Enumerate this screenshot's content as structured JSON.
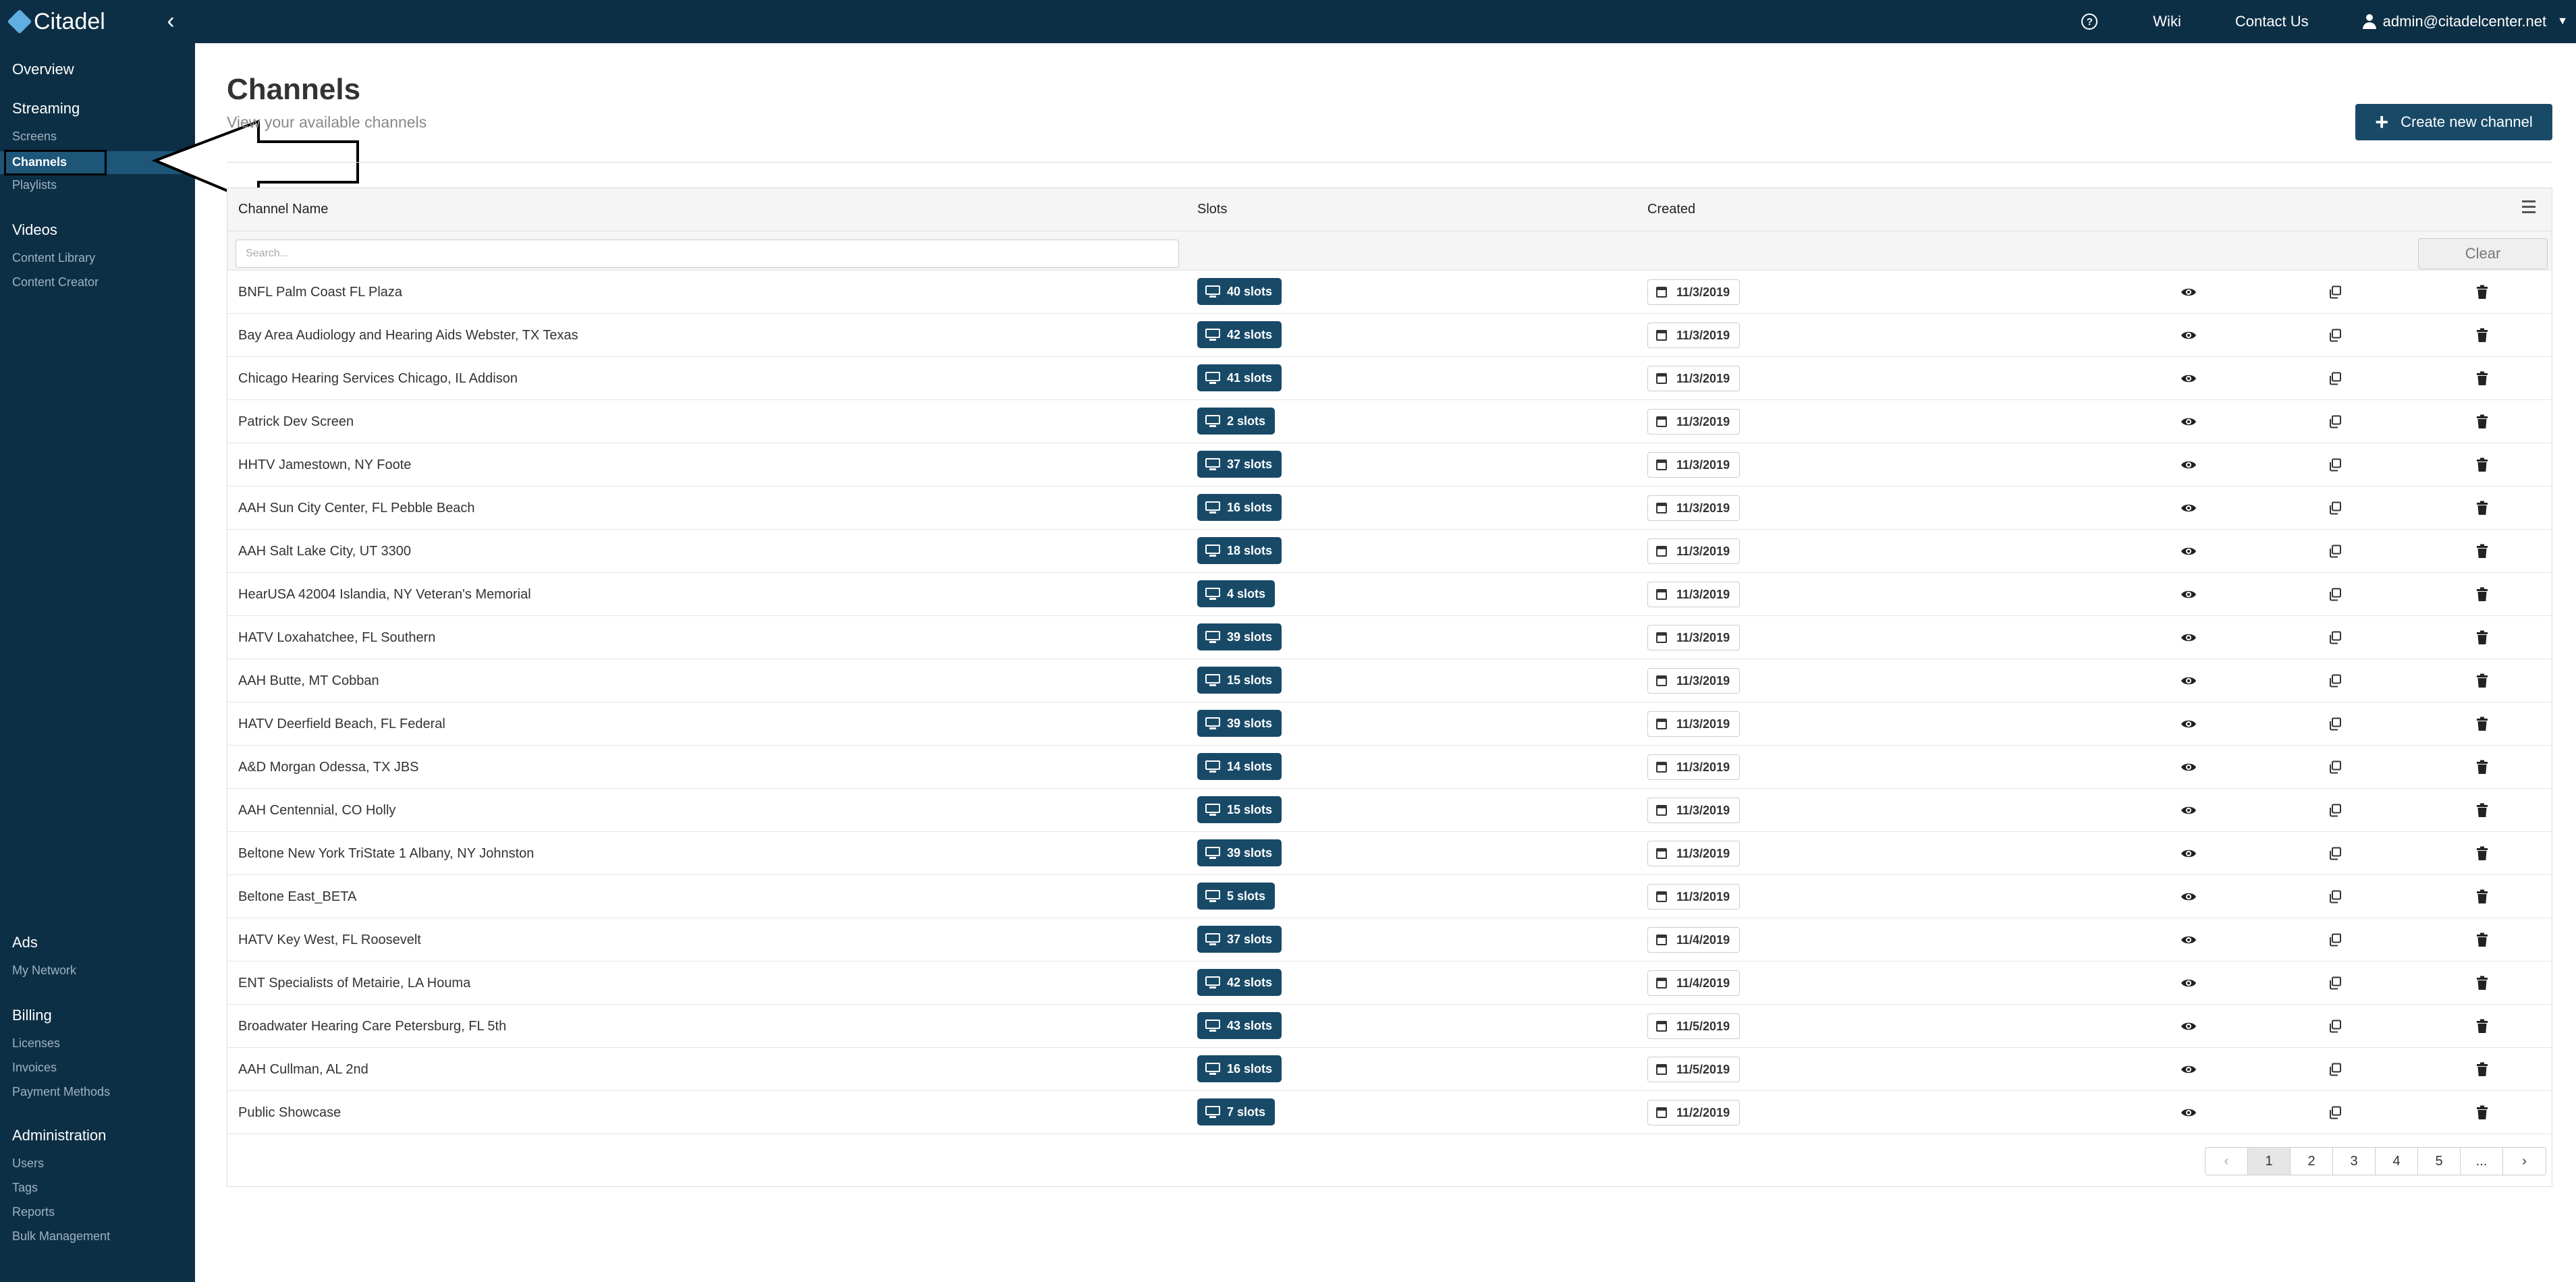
{
  "app": {
    "name": "Citadel"
  },
  "topbar": {
    "links": [
      "Wiki",
      "Contact Us"
    ],
    "user_email": "admin@citadelcenter.net"
  },
  "sidebar": {
    "overview": "Overview",
    "streaming": {
      "title": "Streaming",
      "items": [
        "Screens",
        "Channels",
        "Playlists"
      ],
      "active": "Channels"
    },
    "videos": {
      "title": "Videos",
      "items": [
        "Content Library",
        "Content Creator"
      ]
    },
    "ads": {
      "title": "Ads",
      "items": [
        "My Network"
      ]
    },
    "billing": {
      "title": "Billing",
      "items": [
        "Licenses",
        "Invoices",
        "Payment Methods"
      ]
    },
    "administration": {
      "title": "Administration",
      "items": [
        "Users",
        "Tags",
        "Reports",
        "Bulk Management"
      ]
    }
  },
  "page": {
    "title": "Channels",
    "subtitle": "View your available channels",
    "create_button": "Create new channel"
  },
  "grid": {
    "columns": [
      "Channel Name",
      "Slots",
      "Created"
    ],
    "search_placeholder": "Search...",
    "clear_label": "Clear",
    "rows": [
      {
        "name": "BNFL Palm Coast FL Plaza",
        "slots": "40 slots",
        "created": "11/3/2019"
      },
      {
        "name": "Bay Area Audiology and Hearing Aids Webster, TX Texas",
        "slots": "42 slots",
        "created": "11/3/2019"
      },
      {
        "name": "Chicago Hearing Services Chicago, IL Addison",
        "slots": "41 slots",
        "created": "11/3/2019"
      },
      {
        "name": "Patrick Dev Screen",
        "slots": "2 slots",
        "created": "11/3/2019"
      },
      {
        "name": "HHTV Jamestown, NY Foote",
        "slots": "37 slots",
        "created": "11/3/2019"
      },
      {
        "name": "AAH Sun City Center, FL Pebble Beach",
        "slots": "16 slots",
        "created": "11/3/2019"
      },
      {
        "name": "AAH Salt Lake City, UT 3300",
        "slots": "18 slots",
        "created": "11/3/2019"
      },
      {
        "name": "HearUSA 42004 Islandia, NY Veteran's Memorial",
        "slots": "4 slots",
        "created": "11/3/2019"
      },
      {
        "name": "HATV Loxahatchee, FL Southern",
        "slots": "39 slots",
        "created": "11/3/2019"
      },
      {
        "name": "AAH Butte, MT Cobban",
        "slots": "15 slots",
        "created": "11/3/2019"
      },
      {
        "name": "HATV Deerfield Beach, FL Federal",
        "slots": "39 slots",
        "created": "11/3/2019"
      },
      {
        "name": "A&D Morgan Odessa, TX JBS",
        "slots": "14 slots",
        "created": "11/3/2019"
      },
      {
        "name": "AAH Centennial, CO Holly",
        "slots": "15 slots",
        "created": "11/3/2019"
      },
      {
        "name": "Beltone New York TriState 1 Albany, NY Johnston",
        "slots": "39 slots",
        "created": "11/3/2019"
      },
      {
        "name": "Beltone East_BETA",
        "slots": "5 slots",
        "created": "11/3/2019"
      },
      {
        "name": "HATV Key West, FL Roosevelt",
        "slots": "37 slots",
        "created": "11/4/2019"
      },
      {
        "name": "ENT Specialists of Metairie, LA Houma",
        "slots": "42 slots",
        "created": "11/4/2019"
      },
      {
        "name": "Broadwater Hearing Care Petersburg, FL 5th",
        "slots": "43 slots",
        "created": "11/5/2019"
      },
      {
        "name": "AAH Cullman, AL 2nd",
        "slots": "16 slots",
        "created": "11/5/2019"
      },
      {
        "name": "Public Showcase",
        "slots": "7 slots",
        "created": "11/2/2019"
      }
    ]
  },
  "pagination": {
    "pages": [
      "1",
      "2",
      "3",
      "4",
      "5",
      "..."
    ],
    "current": "1"
  },
  "colors": {
    "navy": "#0d2f45",
    "accent": "#184a68",
    "active_item": "#1d5678"
  }
}
